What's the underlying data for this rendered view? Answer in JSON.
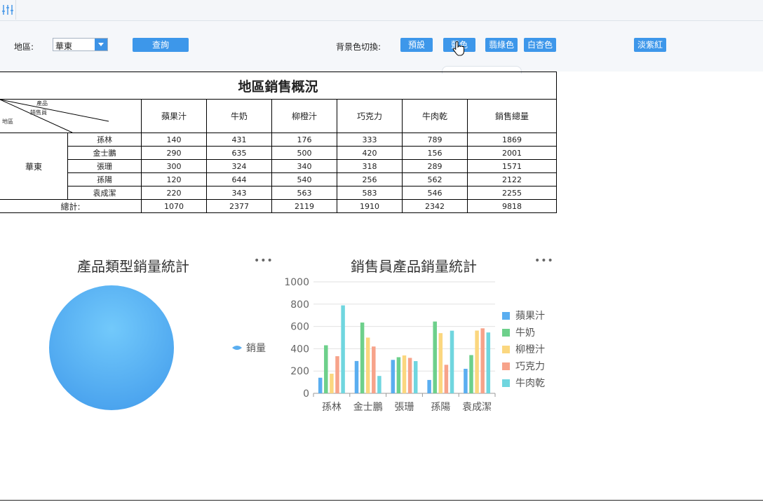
{
  "toolbar": {
    "region_label": "地區:",
    "region_value": "華東",
    "query_label": "查詢",
    "bg_label": "背景色切換:",
    "bg_buttons": [
      "預設",
      "藍色",
      "翡綠色",
      "白杏色",
      "淡紫紅"
    ]
  },
  "report": {
    "title": "地區銷售概況",
    "corner": {
      "product": "產品",
      "salesperson": "銷售員",
      "region": "地區"
    },
    "columns": [
      "蘋果汁",
      "牛奶",
      "柳橙汁",
      "巧克力",
      "牛肉乾",
      "銷售總量"
    ],
    "region": "華東",
    "rows": [
      {
        "name": "孫林",
        "values": [
          "140",
          "431",
          "176",
          "333",
          "789",
          "1869"
        ]
      },
      {
        "name": "金士鵬",
        "values": [
          "290",
          "635",
          "500",
          "420",
          "156",
          "2001"
        ]
      },
      {
        "name": "張珊",
        "values": [
          "300",
          "324",
          "340",
          "318",
          "289",
          "1571"
        ]
      },
      {
        "name": "孫陽",
        "values": [
          "120",
          "644",
          "540",
          "256",
          "562",
          "2122"
        ]
      },
      {
        "name": "袁成潔",
        "values": [
          "220",
          "343",
          "563",
          "583",
          "546",
          "2255"
        ]
      }
    ],
    "total_label": "總計:",
    "totals": [
      "1070",
      "2377",
      "2119",
      "1910",
      "2342",
      "9818"
    ]
  },
  "chart_data": [
    {
      "type": "pie",
      "title": "產品類型銷量統計",
      "series": [
        {
          "name": "銷量",
          "values": [
            100
          ]
        }
      ],
      "legend": "right",
      "colors": [
        "#5aaef0"
      ]
    },
    {
      "type": "bar",
      "title": "銷售員產品銷量統計",
      "categories": [
        "孫林",
        "金士鵬",
        "張珊",
        "孫陽",
        "袁成潔"
      ],
      "series": [
        {
          "name": "蘋果汁",
          "values": [
            140,
            290,
            300,
            120,
            220
          ],
          "color": "#5aaef0"
        },
        {
          "name": "牛奶",
          "values": [
            431,
            635,
            324,
            644,
            343
          ],
          "color": "#6dd08b"
        },
        {
          "name": "柳橙汁",
          "values": [
            176,
            500,
            340,
            540,
            563
          ],
          "color": "#fbd77f"
        },
        {
          "name": "巧克力",
          "values": [
            333,
            420,
            318,
            256,
            583
          ],
          "color": "#f7a38a"
        },
        {
          "name": "牛肉乾",
          "values": [
            789,
            156,
            289,
            562,
            546
          ],
          "color": "#70d6df"
        }
      ],
      "yticks": [
        "0",
        "200",
        "400",
        "600",
        "800",
        "1000"
      ],
      "ylim": [
        0,
        1000
      ],
      "legend": "right",
      "grid": true
    }
  ]
}
